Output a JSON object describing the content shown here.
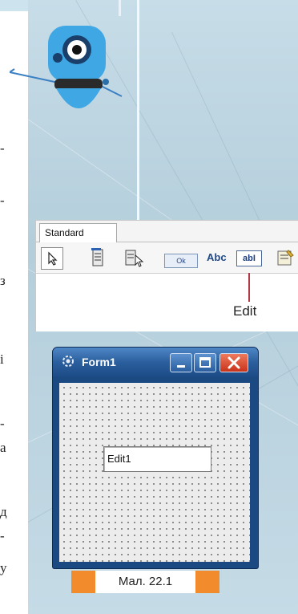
{
  "palette": {
    "tab_label": "Standard",
    "ok_label": "Ok",
    "abc_label": "Abc",
    "edit_icon_label": "ab",
    "pointer_caption": "Edit"
  },
  "form": {
    "title": "Form1",
    "edit_value": "Edit1"
  },
  "caption": "Мал. 22.1",
  "colors": {
    "caption_accent": "#f28b2c",
    "window_frame": "#1b4a83",
    "close_button": "#c8321a"
  }
}
